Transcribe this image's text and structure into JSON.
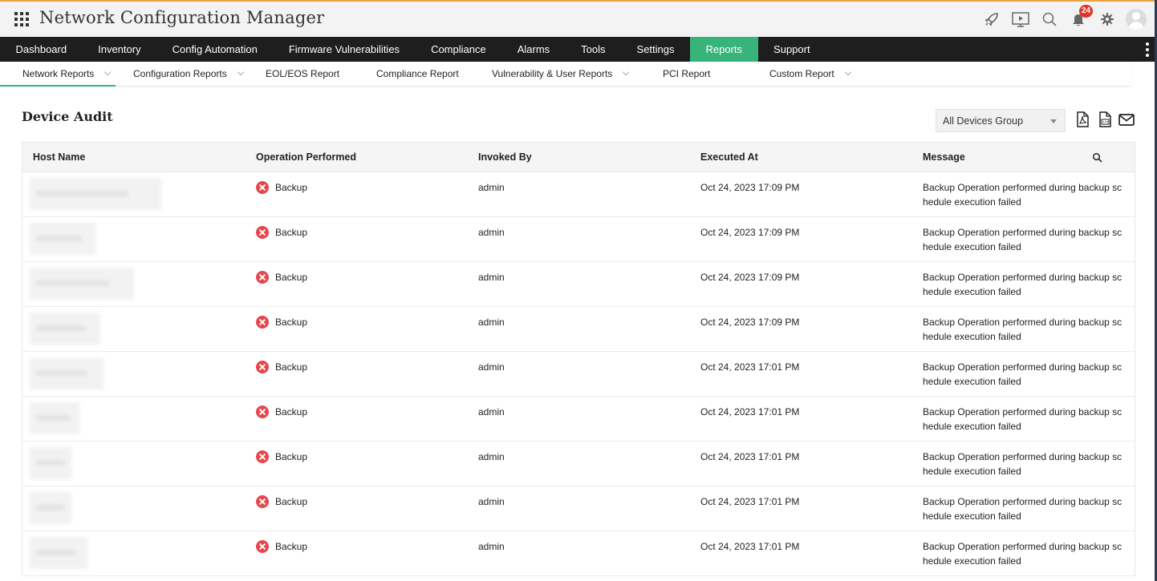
{
  "app": {
    "title": "Network Configuration Manager",
    "notification_count": "24"
  },
  "colors": {
    "accent": "#38b37a",
    "nav_bg": "#1e1e1e",
    "error": "#e5474d",
    "badge": "#e0352b"
  },
  "icons": [
    "apps-grid-icon",
    "rocket-icon",
    "presentation-icon",
    "search-icon",
    "bell-icon",
    "gear-icon",
    "user-avatar-icon"
  ],
  "main_nav": [
    {
      "label": "Dashboard"
    },
    {
      "label": "Inventory"
    },
    {
      "label": "Config Automation"
    },
    {
      "label": "Firmware Vulnerabilities"
    },
    {
      "label": "Compliance"
    },
    {
      "label": "Alarms"
    },
    {
      "label": "Tools"
    },
    {
      "label": "Settings"
    },
    {
      "label": "Reports",
      "active": true
    },
    {
      "label": "Support"
    }
  ],
  "sub_nav": [
    {
      "label": "Network Reports",
      "dropdown": true,
      "active": true
    },
    {
      "label": "Configuration Reports",
      "dropdown": true
    },
    {
      "label": "EOL/EOS Report",
      "dropdown": false
    },
    {
      "label": "Compliance Report",
      "dropdown": false
    },
    {
      "label": "Vulnerability & User Reports",
      "dropdown": true
    },
    {
      "label": "PCI Report",
      "dropdown": false
    },
    {
      "label": "Custom Report",
      "dropdown": true
    }
  ],
  "page": {
    "title": "Device Audit",
    "group_select": "All Devices Group"
  },
  "table": {
    "columns": [
      "Host Name",
      "Operation Performed",
      "Invoked By",
      "Executed At",
      "Message"
    ],
    "rows": [
      {
        "operation": "Backup",
        "invoked_by": "admin",
        "executed_at": "Oct 24, 2023 17:09 PM",
        "message": "Backup Operation performed during backup schedule execution failed"
      },
      {
        "operation": "Backup",
        "invoked_by": "admin",
        "executed_at": "Oct 24, 2023 17:09 PM",
        "message": "Backup Operation performed during backup schedule execution failed"
      },
      {
        "operation": "Backup",
        "invoked_by": "admin",
        "executed_at": "Oct 24, 2023 17:09 PM",
        "message": "Backup Operation performed during backup schedule execution failed"
      },
      {
        "operation": "Backup",
        "invoked_by": "admin",
        "executed_at": "Oct 24, 2023 17:09 PM",
        "message": "Backup Operation performed during backup schedule execution failed"
      },
      {
        "operation": "Backup",
        "invoked_by": "admin",
        "executed_at": "Oct 24, 2023 17:01 PM",
        "message": "Backup Operation performed during backup schedule execution failed"
      },
      {
        "operation": "Backup",
        "invoked_by": "admin",
        "executed_at": "Oct 24, 2023 17:01 PM",
        "message": "Backup Operation performed during backup schedule execution failed"
      },
      {
        "operation": "Backup",
        "invoked_by": "admin",
        "executed_at": "Oct 24, 2023 17:01 PM",
        "message": "Backup Operation performed during backup schedule execution failed"
      },
      {
        "operation": "Backup",
        "invoked_by": "admin",
        "executed_at": "Oct 24, 2023 17:01 PM",
        "message": "Backup Operation performed during backup schedule execution failed"
      },
      {
        "operation": "Backup",
        "invoked_by": "admin",
        "executed_at": "Oct 24, 2023 17:01 PM",
        "message": "Backup Operation performed during backup schedule execution failed"
      }
    ]
  }
}
